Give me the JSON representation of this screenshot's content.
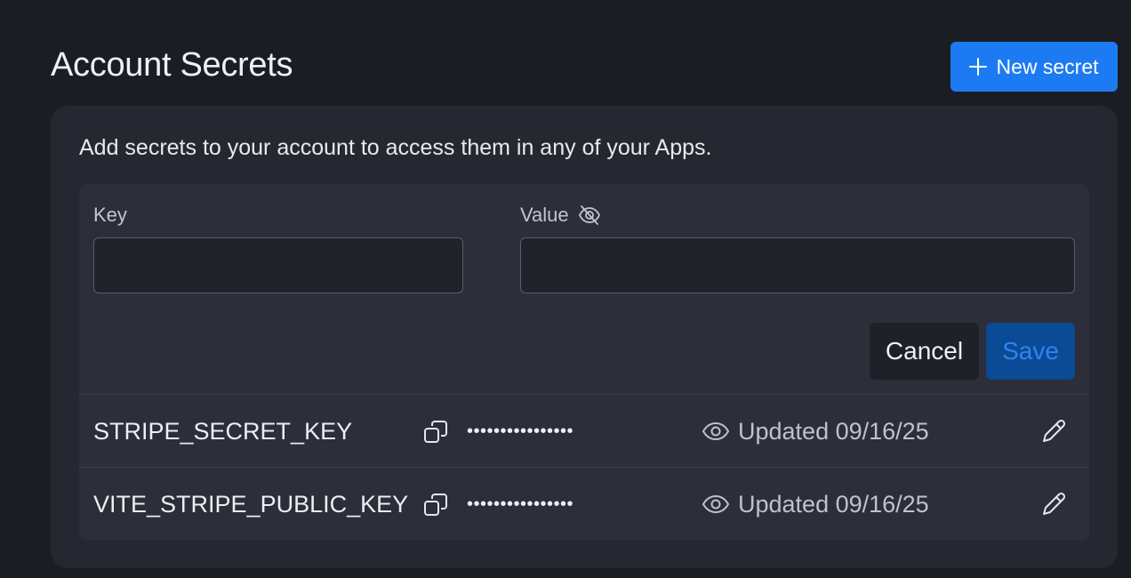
{
  "header": {
    "title": "Account Secrets",
    "new_secret_label": "New secret",
    "new_secret_icon": "plus-icon"
  },
  "card": {
    "description": "Add secrets to your account to access them in any of your Apps."
  },
  "form": {
    "key_label": "Key",
    "key_value": "",
    "value_label": "Value",
    "value_visibility_icon": "eye-off-icon",
    "value_value": "",
    "cancel_label": "Cancel",
    "save_label": "Save"
  },
  "secrets": [
    {
      "key": "STRIPE_SECRET_KEY",
      "masked_value": "••••••••••••••••",
      "updated": "Updated 09/16/25"
    },
    {
      "key": "VITE_STRIPE_PUBLIC_KEY",
      "masked_value": "••••••••••••••••",
      "updated": "Updated 09/16/25"
    }
  ],
  "colors": {
    "background": "#1b1d25",
    "card": "#262831",
    "panel": "#2c2e39",
    "primary": "#1c7bf2",
    "save_bg": "#0b4a94"
  }
}
